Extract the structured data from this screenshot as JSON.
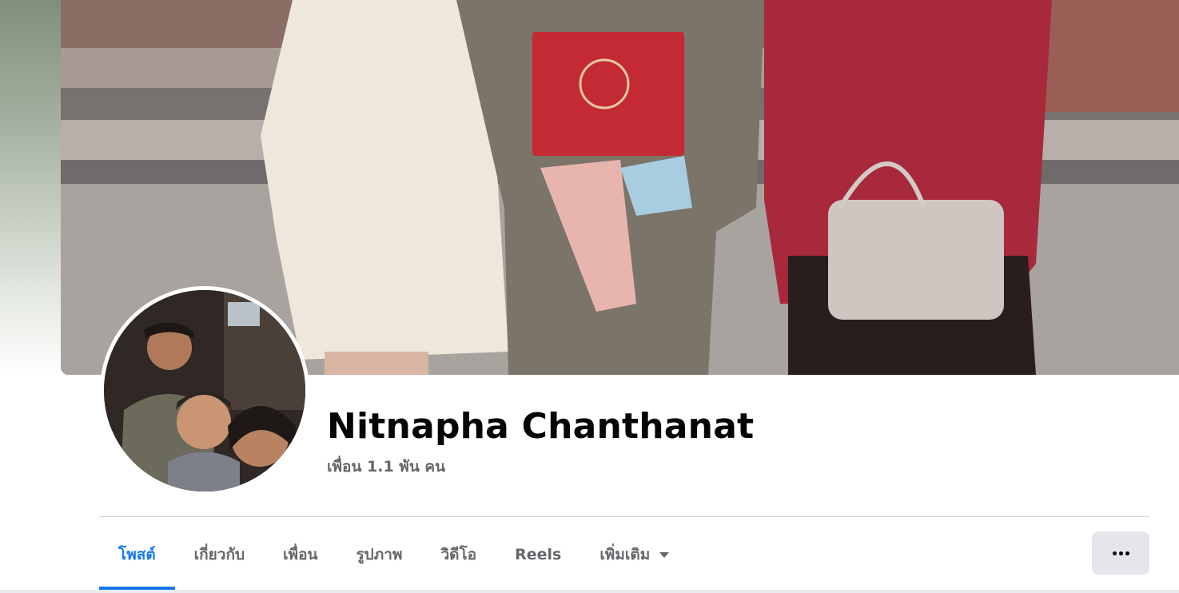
{
  "profile": {
    "name": "Nitnapha Chanthanat",
    "friends_text": "เพื่อน 1.1 พัน คน"
  },
  "tabs": [
    {
      "label": "โพสต์",
      "active": true
    },
    {
      "label": "เกี่ยวกับ",
      "active": false
    },
    {
      "label": "เพื่อน",
      "active": false
    },
    {
      "label": "รูปภาพ",
      "active": false
    },
    {
      "label": "วิดีโอ",
      "active": false
    },
    {
      "label": "Reels",
      "active": false
    },
    {
      "label": "เพิ่มเติม",
      "active": false,
      "has_dropdown": true
    }
  ],
  "more_button": {
    "icon": "more-horizontal-icon"
  },
  "colors": {
    "accent": "#1877f2",
    "text_primary": "#050505",
    "text_secondary": "#65676b",
    "button_bg": "#e4e6eb",
    "divider": "#ced0d4"
  }
}
